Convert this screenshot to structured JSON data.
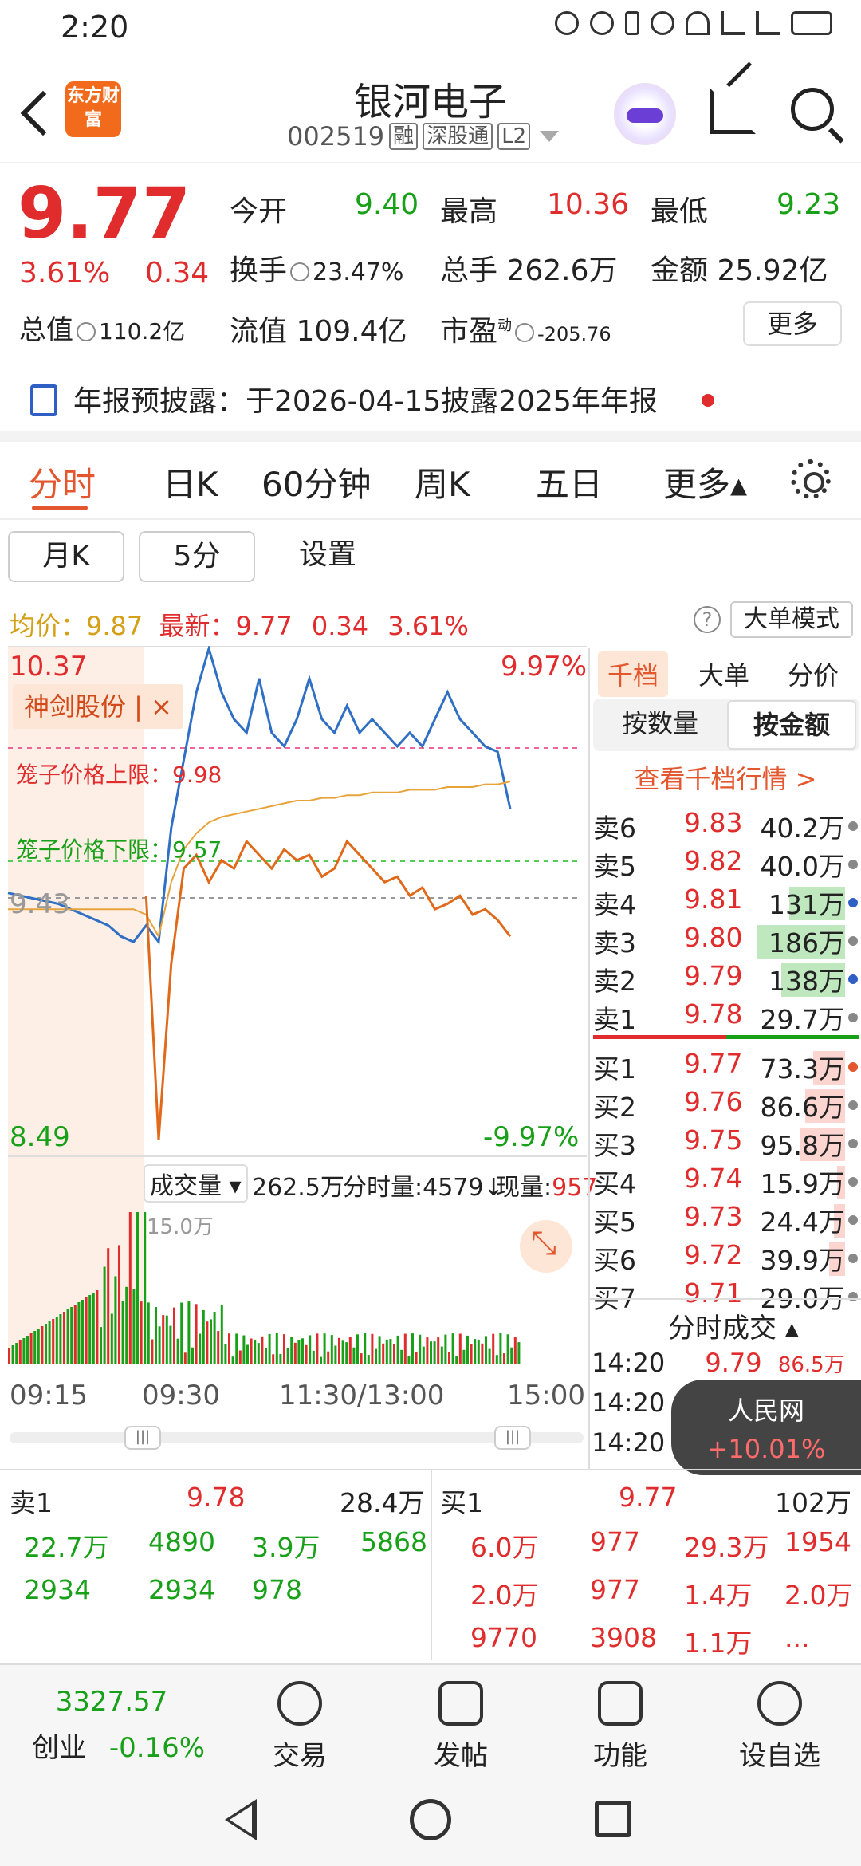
{
  "status": {
    "time": "2:20"
  },
  "header": {
    "logo_text": "东方财富",
    "title": "银河电子",
    "code": "002519",
    "tags": [
      "融",
      "深股通",
      "L2"
    ]
  },
  "quote": {
    "price": "9.77",
    "pct": "3.61%",
    "chg": "0.34",
    "open_label": "今开",
    "open": "9.40",
    "high_label": "最高",
    "high": "10.36",
    "low_label": "最低",
    "low": "9.23",
    "turnover_label": "换手",
    "turnover": "23.47%",
    "volume_label": "总手",
    "volume": "262.6万",
    "amount_label": "金额",
    "amount": "25.92亿",
    "mktcap_label": "总值",
    "mktcap": "110.2亿",
    "float_label": "流值",
    "float": "109.4亿",
    "pe_label": "市盈",
    "pe_sup": "动",
    "pe": "-205.76",
    "more_btn": "更多"
  },
  "notice": {
    "label": "年报预披露：",
    "text": "于2026-04-15披露2025年年报"
  },
  "tabs": [
    "分时",
    "日K",
    "60分钟",
    "周K",
    "五日",
    "更多▴"
  ],
  "subtabs": [
    "月K",
    "5分",
    "设置"
  ],
  "chart_info": {
    "avg_label": "均价：",
    "avg": "9.87",
    "last_label": "最新：",
    "last": "9.77",
    "chg": "0.34",
    "pct": "3.61%",
    "mode_btn": "大单模式"
  },
  "chart_labels": {
    "top_price": "10.37",
    "bottom_price": "8.49",
    "top_pct": "9.97%",
    "bottom_pct": "-9.97%",
    "ref_price": "9.43",
    "tag": "神剑股份 | ×",
    "upper_limit": "笼子价格上限：9.98",
    "lower_limit": "笼子价格下限：9.57"
  },
  "chart_data": {
    "type": "line",
    "series": [
      {
        "values": [
          9.46,
          9.45,
          9.44,
          9.43,
          9.42,
          9.4,
          9.38,
          9.36,
          9.34,
          9.3,
          9.28,
          9.34,
          9.28,
          9.7,
          9.95,
          10.2,
          10.36,
          10.2,
          10.1,
          10.05,
          10.25,
          10.05,
          10.0,
          10.1,
          10.25,
          10.1,
          10.05,
          10.15,
          10.05,
          10.1,
          10.05,
          10.0,
          10.05,
          10.0,
          10.1,
          10.2,
          10.1,
          10.05,
          10.0,
          9.98,
          9.77
        ]
      },
      {
        "values": [
          9.4,
          9.4,
          9.4,
          9.4,
          9.4,
          9.4,
          9.4,
          9.4,
          9.4,
          9.4,
          9.4,
          9.38,
          9.3,
          9.5,
          9.62,
          9.68,
          9.72,
          9.74,
          9.75,
          9.76,
          9.77,
          9.78,
          9.79,
          9.8,
          9.8,
          9.81,
          9.81,
          9.82,
          9.82,
          9.83,
          9.83,
          9.83,
          9.84,
          9.84,
          9.84,
          9.85,
          9.85,
          9.85,
          9.86,
          9.86,
          9.87
        ]
      },
      {
        "values": [
          null,
          null,
          null,
          null,
          null,
          null,
          null,
          null,
          null,
          null,
          null,
          9.45,
          8.55,
          9.2,
          9.55,
          9.6,
          9.5,
          9.58,
          9.55,
          9.65,
          9.6,
          9.55,
          9.62,
          9.58,
          9.6,
          9.52,
          9.55,
          9.65,
          9.6,
          9.55,
          9.5,
          9.52,
          9.45,
          9.48,
          9.4,
          9.42,
          9.45,
          9.38,
          9.4,
          9.36,
          9.3
        ]
      }
    ],
    "ylim": [
      8.49,
      10.37
    ],
    "xlabels": [
      "09:15",
      "09:30",
      "11:30/13:00",
      "15:00"
    ]
  },
  "volume": {
    "label": "成交量",
    "total": "262.5万",
    "tick_label": "分时量:4579↓",
    "now_label": "现量:",
    "now": "957",
    "axis_max": "15.0万"
  },
  "book": {
    "tabs": [
      "千档",
      "大单",
      "分价"
    ],
    "seg": [
      "按数量",
      "按金额"
    ],
    "link": "查看千档行情 >",
    "asks": [
      {
        "label": "卖6",
        "price": "9.83",
        "vol": "40.2万",
        "dot": "#888888",
        "bar": 0.0
      },
      {
        "label": "卖5",
        "price": "9.82",
        "vol": "40.0万",
        "dot": "#888888",
        "bar": 0.0
      },
      {
        "label": "卖4",
        "price": "9.81",
        "vol": "131万",
        "dot": "#2f5ec4",
        "bar": 0.35
      },
      {
        "label": "卖3",
        "price": "9.80",
        "vol": "186万",
        "dot": "#888888",
        "bar": 0.55
      },
      {
        "label": "卖2",
        "price": "9.79",
        "vol": "138万",
        "dot": "#2f5ec4",
        "bar": 0.4
      },
      {
        "label": "卖1",
        "price": "9.78",
        "vol": "29.7万",
        "dot": "#888888",
        "bar": 0.0
      }
    ],
    "bids": [
      {
        "label": "买1",
        "price": "9.77",
        "vol": "73.3万",
        "dot": "#e4572e",
        "bar": 0.2
      },
      {
        "label": "买2",
        "price": "9.76",
        "vol": "86.6万",
        "dot": "#888888",
        "bar": 0.25
      },
      {
        "label": "买3",
        "price": "9.75",
        "vol": "95.8万",
        "dot": "#888888",
        "bar": 0.28
      },
      {
        "label": "买4",
        "price": "9.74",
        "vol": "15.9万",
        "dot": "#888888",
        "bar": 0.05
      },
      {
        "label": "买5",
        "price": "9.73",
        "vol": "24.4万",
        "dot": "#888888",
        "bar": 0.07
      },
      {
        "label": "买6",
        "price": "9.72",
        "vol": "39.9万",
        "dot": "#888888",
        "bar": 0.1
      },
      {
        "label": "买7",
        "price": "9.71",
        "vol": "29.0万",
        "dot": "#888888",
        "bar": 0.0
      }
    ]
  },
  "ticks": {
    "title": "分时成交",
    "rows": [
      {
        "time": "14:20",
        "price": "9.79",
        "vol": "86.5万"
      },
      {
        "time": "14:20",
        "price": "",
        "vol": ""
      },
      {
        "time": "14:20",
        "price": "",
        "vol": ""
      }
    ]
  },
  "toast": {
    "a": "人民网",
    "b": "+10.01%"
  },
  "order_summary": {
    "left": {
      "label": "卖1",
      "price": "9.78",
      "total": "28.4万",
      "rows": [
        [
          "22.7万",
          "4890",
          "3.9万",
          "5868"
        ],
        [
          "2934",
          "2934",
          "978",
          ""
        ]
      ]
    },
    "right": {
      "label": "买1",
      "price": "9.77",
      "total": "102万",
      "rows": [
        [
          "6.0万",
          "977",
          "29.3万",
          "1954"
        ],
        [
          "2.0万",
          "977",
          "1.4万",
          "2.0万"
        ],
        [
          "9770",
          "3908",
          "1.1万",
          "..."
        ]
      ]
    }
  },
  "nav": {
    "index_value": "3327.57",
    "index_name": "创业",
    "index_pct": "-0.16%",
    "items": [
      "交易",
      "发帖",
      "功能",
      "设自选"
    ]
  },
  "colors": {
    "up": "#e02c2c",
    "down": "#18a118",
    "accent": "#e4572e",
    "price_line": "#2f6fc4",
    "avg_line": "#e8a33a",
    "other_line": "#e06a1a"
  }
}
